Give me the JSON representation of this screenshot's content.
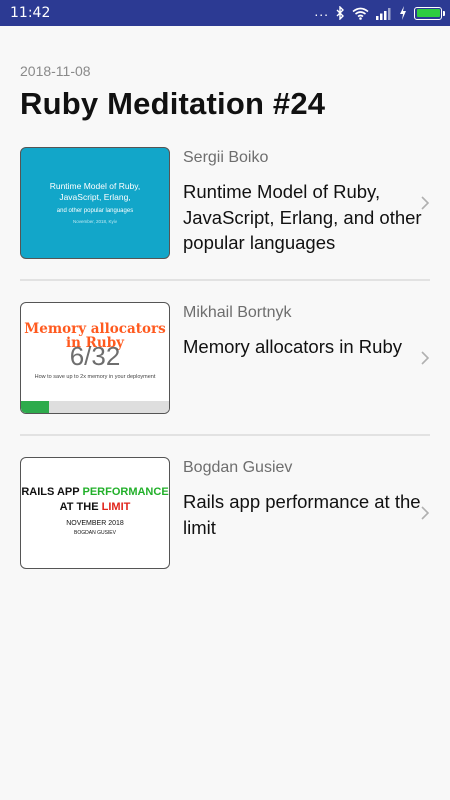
{
  "status_bar": {
    "time": "11:42",
    "dots": "..."
  },
  "page": {
    "date": "2018-11-08",
    "title": "Ruby Meditation #24"
  },
  "talks": [
    {
      "speaker": "Sergii Boiko",
      "title": "Runtime Model of Ruby, JavaScript, Erlang, and other popular languages",
      "thumbnail": {
        "line1": "Runtime Model of Ruby,",
        "line2": "JavaScript, Erlang,",
        "line3": "and other popular languages",
        "line4": "November, 2018, Kyiv"
      }
    },
    {
      "speaker": "Mikhail Bortnyk",
      "title": "Memory allocators in Ruby",
      "thumbnail": {
        "heading_line1": "Memory allocators",
        "heading_line2": "in Ruby",
        "counter": "6/32",
        "subtitle": "How to save up to 2x memory in your deployment",
        "progress": 0.1875
      }
    },
    {
      "speaker": "Bogdan Gusiev",
      "title": "Rails app performance at the limit",
      "thumbnail": {
        "part1": "RAILS APP",
        "part2": "PERFORMANCE",
        "part3": "AT THE",
        "part4": "LIMIT",
        "date": "NOVEMBER 2018",
        "author": "BOGDAN GUSIEV"
      }
    }
  ],
  "colors": {
    "status_bar": "#2c3a93",
    "thumb1_bg": "#12a6c9",
    "accent_orange": "#ff5a1f",
    "progress_green": "#2dab4c"
  }
}
